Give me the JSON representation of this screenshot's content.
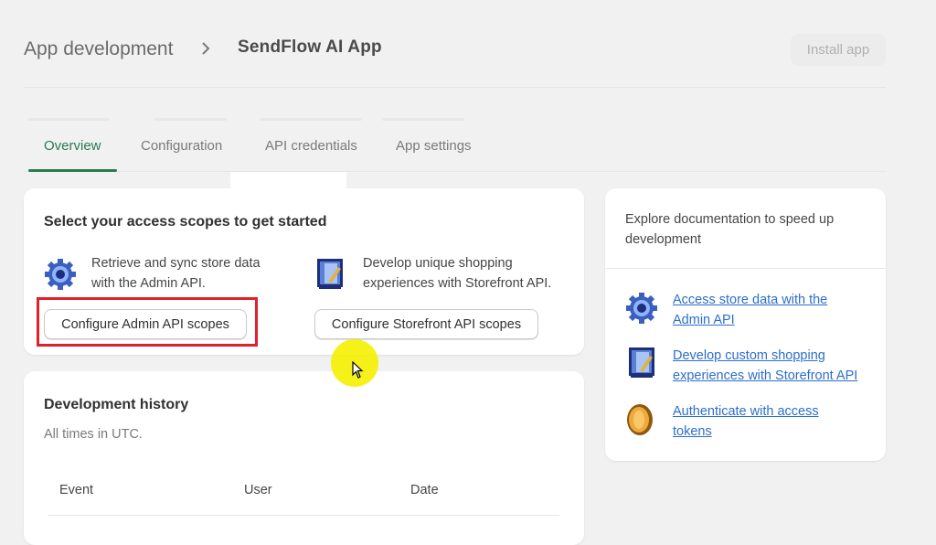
{
  "header": {
    "breadcrumb_parent": "App development",
    "title": "SendFlow AI App",
    "install_button": "Install app"
  },
  "tabs": [
    {
      "label": "Overview",
      "active": true
    },
    {
      "label": "Configuration",
      "active": false
    },
    {
      "label": "API credentials",
      "active": false
    },
    {
      "label": "App settings",
      "active": false
    }
  ],
  "scopes_card": {
    "heading": "Select your access scopes to get started",
    "admin": {
      "line1": "Retrieve and sync store data",
      "line2": "with the Admin API.",
      "button": "Configure Admin API scopes",
      "icon": "gear-icon"
    },
    "storefront": {
      "line1": "Develop unique shopping",
      "line2": "experiences with Storefront API.",
      "button": "Configure Storefront API scopes",
      "icon": "storefront-icon"
    }
  },
  "history_card": {
    "heading": "Development history",
    "subtitle": "All times in UTC.",
    "columns": [
      "Event",
      "User",
      "Date"
    ]
  },
  "docs_card": {
    "intro_line1": "Explore documentation to speed up",
    "intro_line2": "development",
    "links": [
      {
        "line1": "Access store data with the",
        "line2": "Admin API",
        "icon": "gear-icon"
      },
      {
        "line1": "Develop custom shopping",
        "line2": "experiences with Storefront API",
        "icon": "storefront-icon"
      },
      {
        "line1": "Authenticate with access",
        "line2": "tokens",
        "icon": "token-icon"
      }
    ]
  },
  "colors": {
    "accent_green": "#2b7a52",
    "link_blue": "#2c6ecb",
    "highlight_red": "#e0202a",
    "cursor_highlight": "#f4f000"
  }
}
